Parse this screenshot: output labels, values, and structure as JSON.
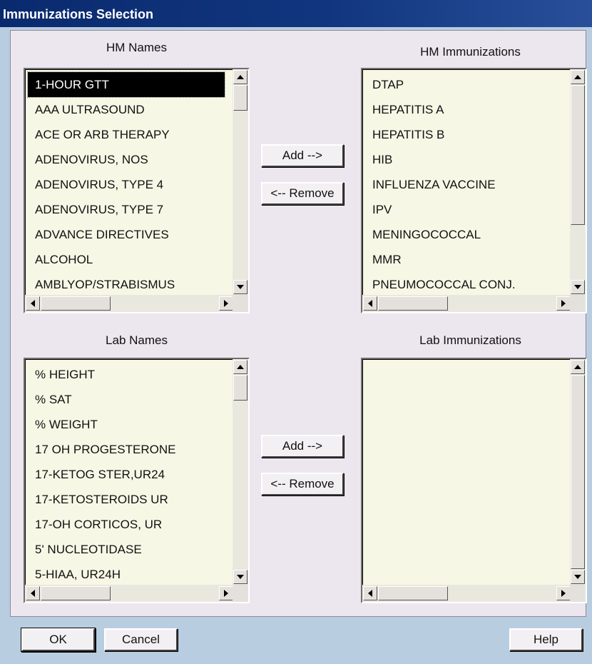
{
  "window": {
    "title": "Immunizations Selection"
  },
  "hm_names": {
    "label": "HM Names",
    "items": [
      "1-HOUR GTT",
      "AAA ULTRASOUND",
      "ACE OR ARB THERAPY",
      "ADENOVIRUS, NOS",
      "ADENOVIRUS, TYPE 4",
      "ADENOVIRUS, TYPE 7",
      "ADVANCE DIRECTIVES",
      "ALCOHOL",
      "AMBLYOP/STRABISMUS"
    ],
    "selected": "1-HOUR GTT"
  },
  "hm_immunizations": {
    "label": "HM Immunizations",
    "items": [
      "DTAP",
      "HEPATITIS A",
      "HEPATITIS B",
      "HIB",
      "INFLUENZA VACCINE",
      "IPV",
      "MENINGOCOCCAL",
      "MMR",
      "PNEUMOCOCCAL CONJ."
    ]
  },
  "lab_names": {
    "label": "Lab Names",
    "items": [
      "% HEIGHT",
      "% SAT",
      "% WEIGHT",
      "17 OH PROGESTERONE",
      "17-KETOG STER,UR24",
      "17-KETOSTEROIDS UR",
      "17-OH CORTICOS, UR",
      "5' NUCLEOTIDASE",
      "5-HIAA, UR24H"
    ]
  },
  "lab_immunizations": {
    "label": "Lab Immunizations",
    "items": []
  },
  "buttons": {
    "add": "Add -->",
    "remove": "<-- Remove",
    "ok": "OK",
    "cancel": "Cancel",
    "help": "Help"
  },
  "colors": {
    "title_bar": "#0a2a6e",
    "dialog_bg": "#ece6ee",
    "frame_bg": "#b9cde0",
    "listbox_bg": "#f7f7e6"
  }
}
